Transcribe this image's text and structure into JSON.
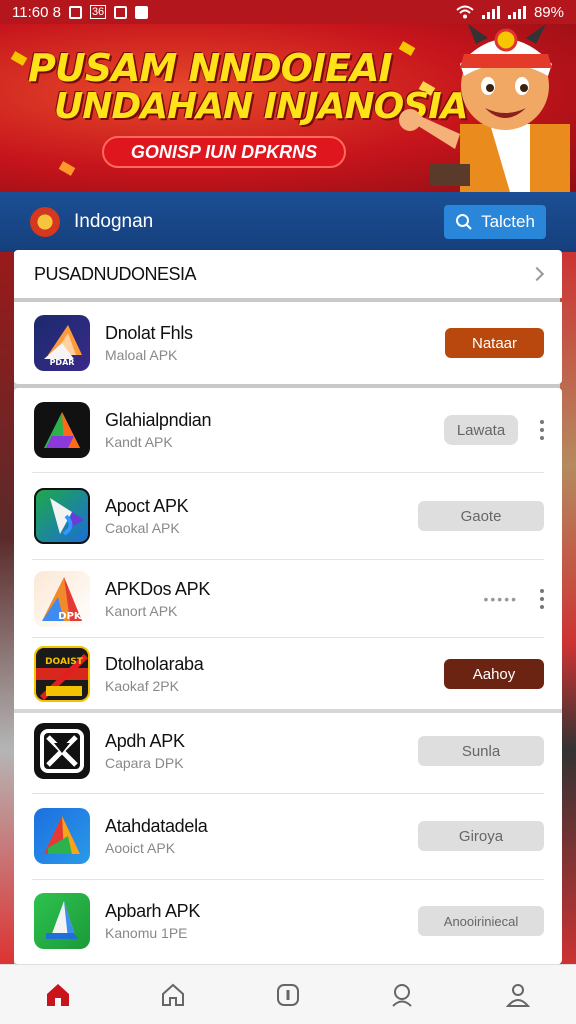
{
  "status_bar": {
    "time": "11:60 8",
    "battery": "89%",
    "badge": "36"
  },
  "banner": {
    "line1": "PUSAM NNDOIEAI",
    "line2": "UNDAHAN INJANOSIA",
    "pill": "GONISP IUN DPKRNS"
  },
  "header": {
    "title": "Indognan",
    "search_label": "Talcteh"
  },
  "section": {
    "title": "PUSADNUDONESIA"
  },
  "featured": {
    "name": "Dnolat Fhls",
    "subtitle": "Maloal APK",
    "button": "Nataar",
    "icon_text": "PDAR"
  },
  "apps": [
    {
      "name": "Glahialpndian",
      "subtitle": "Kandt APK",
      "button": "Lawata"
    },
    {
      "name": "Apoct APK",
      "subtitle": "Caokal APK",
      "button": "Gaote"
    },
    {
      "name": "APKDos APK",
      "subtitle": "Kanort APK",
      "button": "•••••",
      "icon_text": "DPK"
    },
    {
      "name": "Dtolholaraba",
      "subtitle": "Kaokaf 2PK",
      "button": "Aahoy",
      "icon_text": "DOAIST"
    },
    {
      "name": "Apdh APK",
      "subtitle": "Capara DPK",
      "button": "Sunla"
    },
    {
      "name": "Atahdatadela",
      "subtitle": "Aooict APK",
      "button": "Giroya"
    },
    {
      "name": "Apbarh APK",
      "subtitle": "Kanomu 1PE",
      "button": "Anooiriniecal"
    }
  ],
  "nav": [
    "home-filled-icon",
    "home-outline-icon",
    "info-icon",
    "person-search-icon",
    "profile-icon"
  ],
  "colors": {
    "red": "#c6141c",
    "blue": "#1b4f95",
    "accent_blue": "#2a86d8",
    "orange": "#b8480d",
    "brown": "#6b2412"
  }
}
